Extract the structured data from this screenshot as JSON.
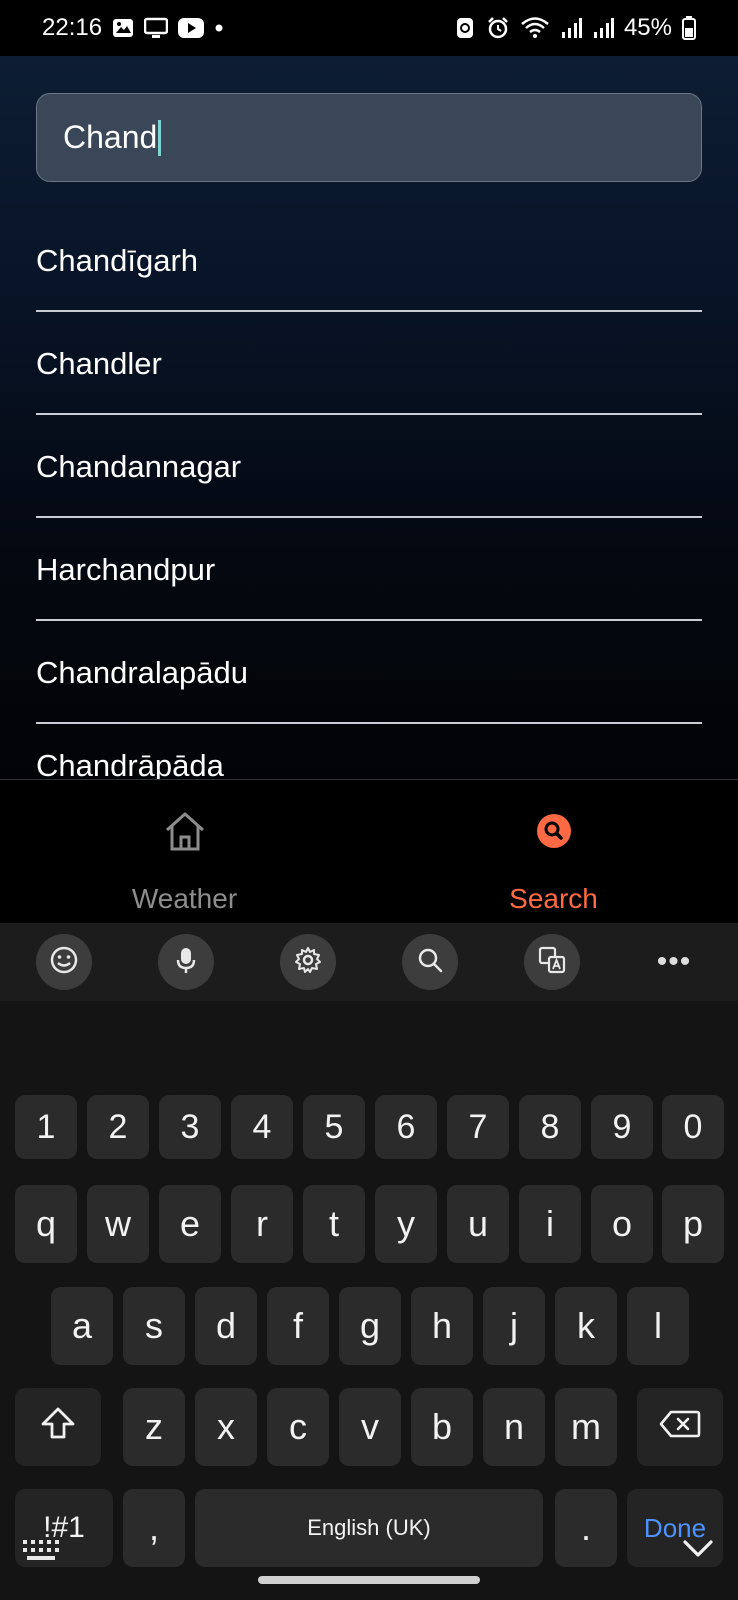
{
  "status": {
    "time": "22:16",
    "battery": "45%",
    "icons": [
      "gallery-icon",
      "screen-cast-icon",
      "youtube-icon",
      "dot-icon",
      "battery-saver-icon",
      "alarm-icon",
      "wifi-icon",
      "signal-icon",
      "signal-icon",
      "battery-icon"
    ]
  },
  "search": {
    "value": "Chand"
  },
  "results": [
    "Chandīgarh",
    "Chandler",
    "Chandannagar",
    "Harchandpur",
    "Chandralapādu",
    "Chandrāpāda"
  ],
  "nav": {
    "weather": "Weather",
    "search": "Search",
    "active": "search",
    "active_color": "#ff6a45"
  },
  "keyboard": {
    "toolbar": [
      "emoji-icon",
      "mic-icon",
      "settings-icon",
      "search-icon",
      "translate-icon",
      "more-icon"
    ],
    "more_label": "•••",
    "numbers": [
      "1",
      "2",
      "3",
      "4",
      "5",
      "6",
      "7",
      "8",
      "9",
      "0"
    ],
    "row1": [
      "q",
      "w",
      "e",
      "r",
      "t",
      "y",
      "u",
      "i",
      "o",
      "p"
    ],
    "row2": [
      "a",
      "s",
      "d",
      "f",
      "g",
      "h",
      "j",
      "k",
      "l"
    ],
    "row3": [
      "z",
      "x",
      "c",
      "v",
      "b",
      "n",
      "m"
    ],
    "symbols": "!#1",
    "comma": ",",
    "space": "English (UK)",
    "period": ".",
    "done": "Done",
    "done_color": "#4d93ff"
  }
}
